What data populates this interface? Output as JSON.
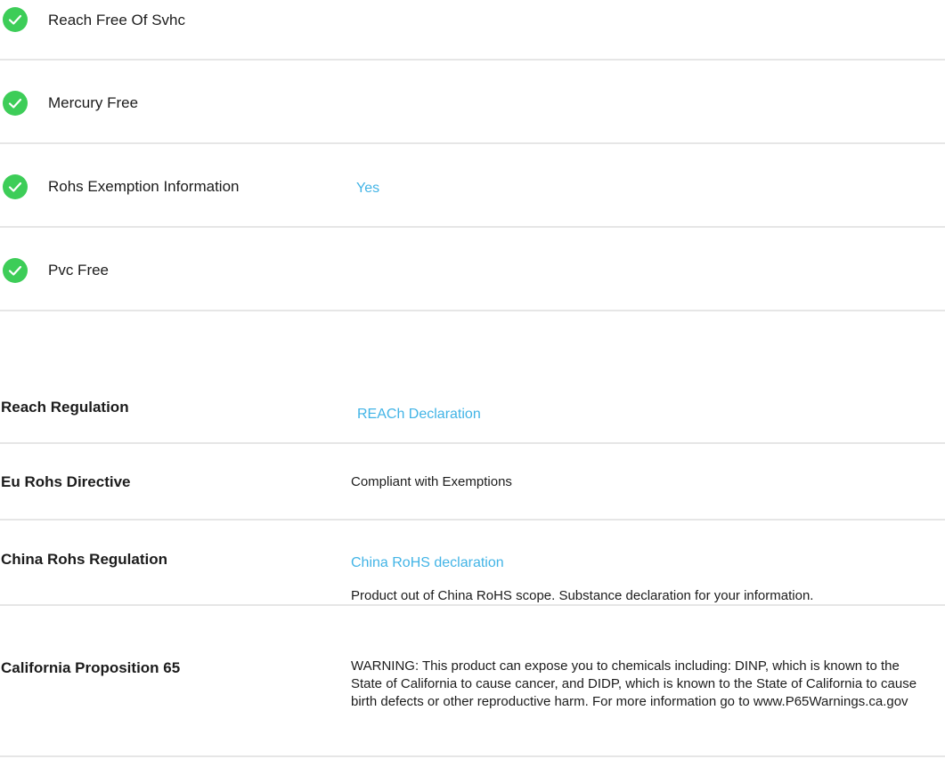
{
  "environment": {
    "items": [
      {
        "label": "Reach Free Of Svhc",
        "value": ""
      },
      {
        "label": "Mercury Free",
        "value": ""
      },
      {
        "label": "Rohs Exemption Information",
        "value": "Yes"
      },
      {
        "label": "Pvc Free",
        "value": ""
      }
    ]
  },
  "regulations": {
    "reach": {
      "label": "Reach Regulation",
      "link": "REACh Declaration"
    },
    "eu_rohs": {
      "label": "Eu Rohs Directive",
      "value": "Compliant with Exemptions"
    },
    "china_rohs": {
      "label": "China Rohs Regulation",
      "link": "China RoHS declaration",
      "note": "Product out of China RoHS scope. Substance declaration for your information."
    },
    "prop65": {
      "label": "California Proposition 65",
      "text": "WARNING: This product can expose you to chemicals including: DINP, which is known to the State of California to cause cancer, and DIDP, which is known to the State of California to cause birth defects or other reproductive harm. For more information go to www.P65Warnings.ca.gov"
    }
  },
  "colors": {
    "check_green": "#3dcd58",
    "link_blue": "#42b4e6",
    "divider": "#e6e6e6"
  },
  "icons": {
    "check": "check-circle-icon"
  }
}
